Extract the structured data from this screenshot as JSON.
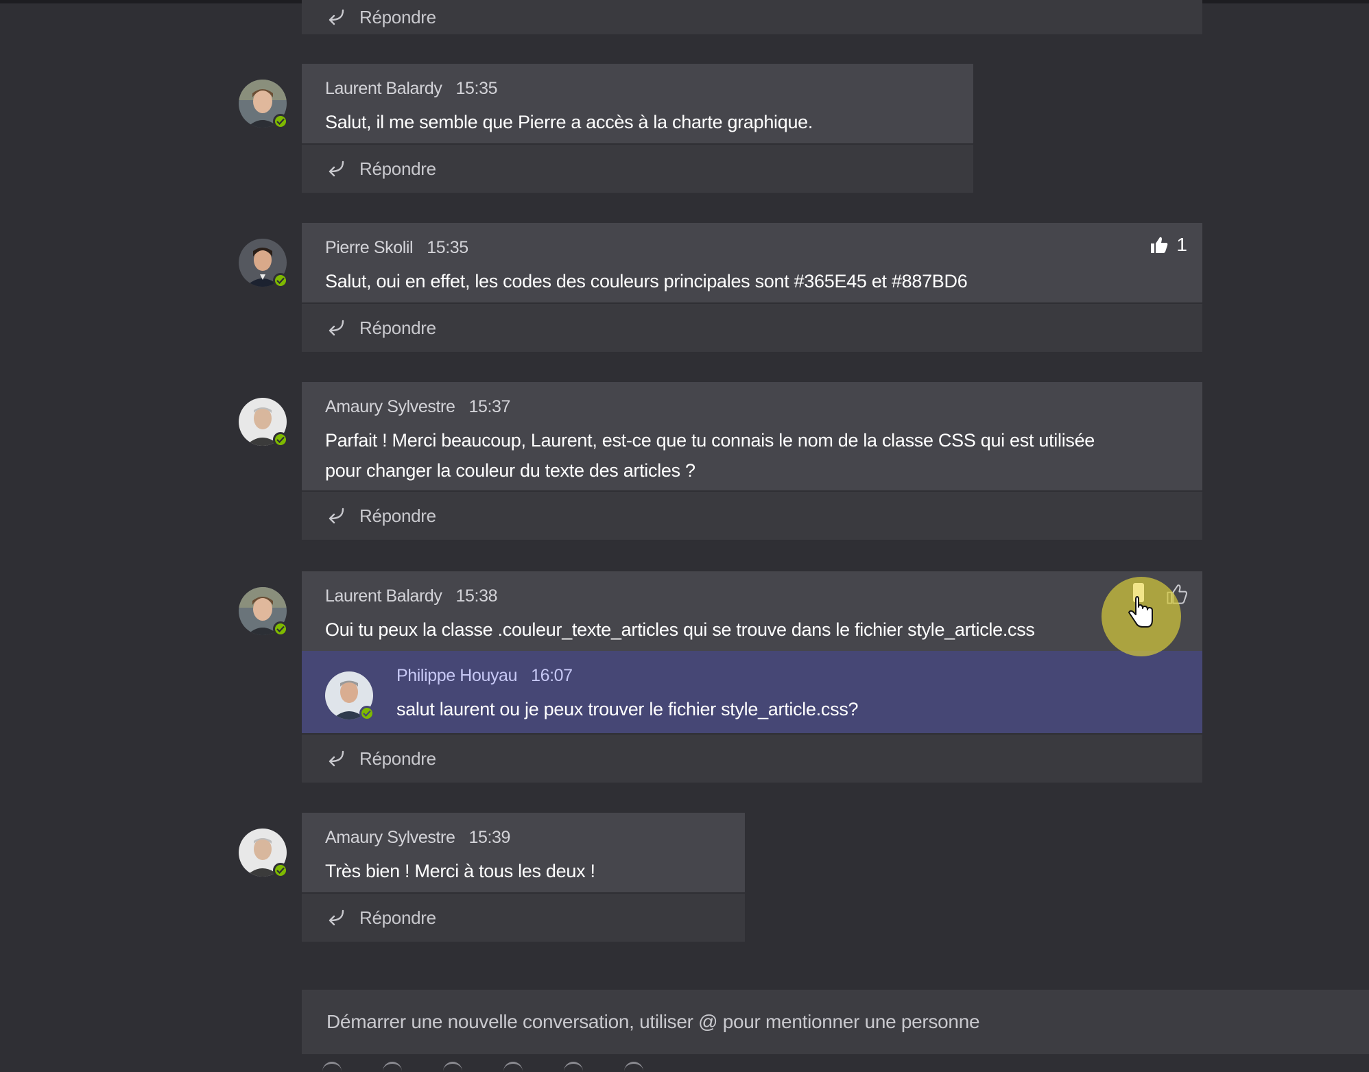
{
  "reply_label": "Répondre",
  "threads": [
    {
      "author": "Laurent Balardy",
      "time": "15:35",
      "text": "Salut, il me semble que Pierre a accès à la charte graphique."
    },
    {
      "author": "Pierre Skolil",
      "time": "15:35",
      "text": "Salut, oui en effet, les codes des couleurs principales sont #365E45 et #887BD6",
      "likes": "1"
    },
    {
      "author": "Amaury Sylvestre",
      "time": "15:37",
      "text_line1": "Parfait ! Merci beaucoup, Laurent, est-ce que tu connais le nom de la classe CSS qui est utilisée",
      "text_line2": "pour changer la couleur du texte des articles ?"
    },
    {
      "author": "Laurent Balardy",
      "time": "15:38",
      "text": "Oui tu peux la classe .couleur_texte_articles qui se trouve dans le fichier style_article.css",
      "reply": {
        "author": "Philippe Houyau",
        "time": "16:07",
        "text": "salut laurent ou je peux trouver le fichier style_article.css?"
      }
    },
    {
      "author": "Amaury Sylvestre",
      "time": "15:39",
      "text": "Très bien ! Merci à tous les deux !"
    }
  ],
  "compose": {
    "placeholder": "Démarrer une nouvelle conversation, utiliser @ pour mentionner une personne"
  },
  "colors": {
    "background": "#2f2f34",
    "message_bg": "#46464c",
    "reply_bar_bg": "#3a3a3f",
    "nested_reply_bg": "#464775",
    "presence_available": "#7fba00",
    "cursor_highlight": "#d2c83c"
  },
  "icons": [
    "reply-arrow-icon",
    "thumbs-up-icon",
    "like-icon",
    "presence-check-icon",
    "hand-cursor-icon"
  ]
}
